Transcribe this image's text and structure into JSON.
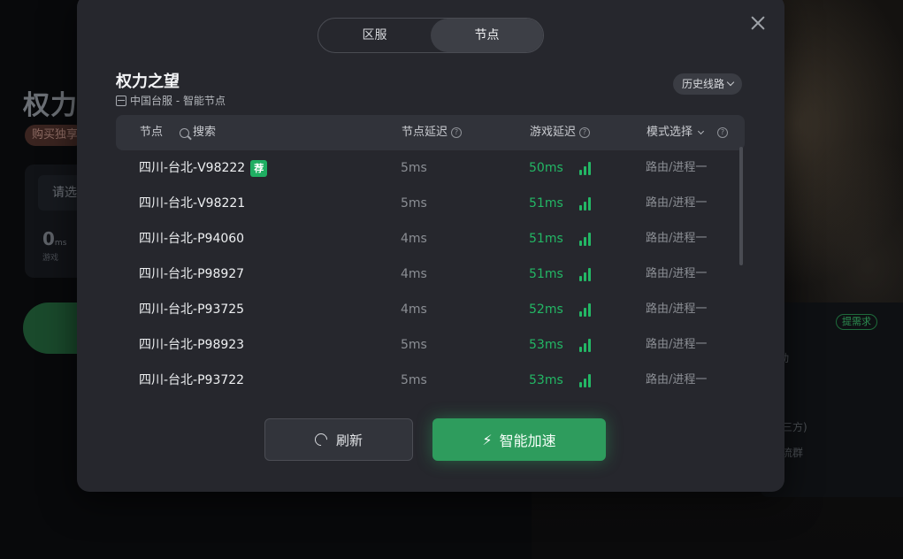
{
  "background": {
    "title": "权力之",
    "badge": "购买独享",
    "select_placeholder": "请选",
    "stat_value": "0",
    "stat_unit": "ms",
    "stat_label": "游戏",
    "demand_label": "提需求",
    "side_lines": [
      "动",
      "三方)",
      "流群"
    ]
  },
  "modal": {
    "tabs": [
      {
        "label": "区服",
        "active": false
      },
      {
        "label": "节点",
        "active": true
      }
    ],
    "game_title": "权力之望",
    "game_subtitle": "中国台服 - 智能节点",
    "history_label": "历史线路",
    "columns": {
      "node": "节点",
      "search": "搜索",
      "node_latency": "节点延迟",
      "game_latency": "游戏延迟",
      "mode": "模式选择"
    },
    "rows": [
      {
        "name": "四川-台北-V98222",
        "recommended": true,
        "recommend_label": "荐",
        "node_latency": "5ms",
        "game_latency": "50ms",
        "mode": "路由/进程一"
      },
      {
        "name": "四川-台北-V98221",
        "recommended": false,
        "node_latency": "5ms",
        "game_latency": "51ms",
        "mode": "路由/进程一"
      },
      {
        "name": "四川-台北-P94060",
        "recommended": false,
        "node_latency": "4ms",
        "game_latency": "51ms",
        "mode": "路由/进程一"
      },
      {
        "name": "四川-台北-P98927",
        "recommended": false,
        "node_latency": "4ms",
        "game_latency": "51ms",
        "mode": "路由/进程一"
      },
      {
        "name": "四川-台北-P93725",
        "recommended": false,
        "node_latency": "4ms",
        "game_latency": "52ms",
        "mode": "路由/进程一"
      },
      {
        "name": "四川-台北-P98923",
        "recommended": false,
        "node_latency": "5ms",
        "game_latency": "53ms",
        "mode": "路由/进程一"
      },
      {
        "name": "四川-台北-P93722",
        "recommended": false,
        "node_latency": "5ms",
        "game_latency": "53ms",
        "mode": "路由/进程一"
      }
    ],
    "refresh_label": "刷新",
    "boost_label": "智能加速",
    "colors": {
      "accent_green": "#2e9c5d",
      "latency_green": "#23b765",
      "modal_bg": "#26272d"
    }
  }
}
